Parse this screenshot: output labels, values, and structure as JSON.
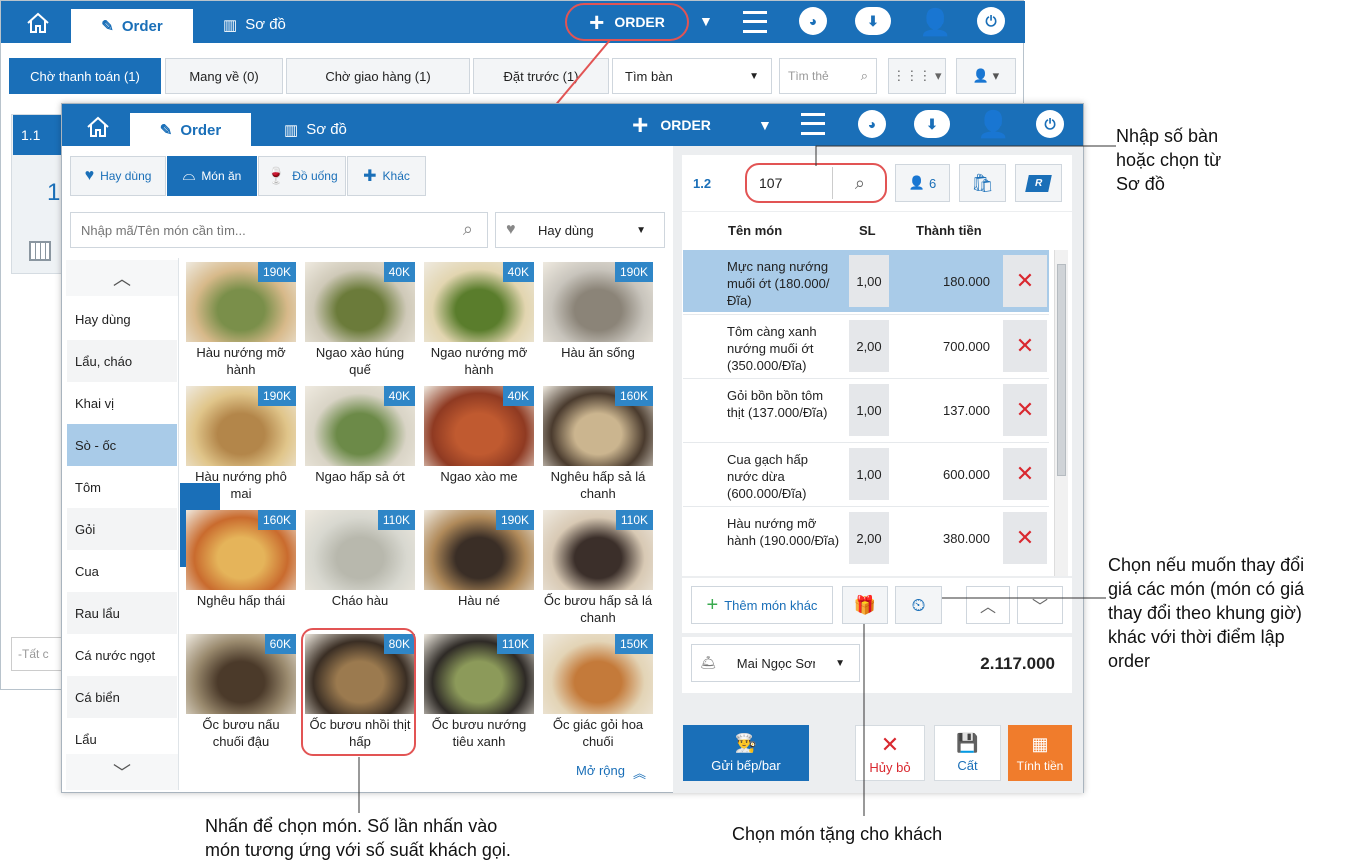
{
  "back_window": {
    "tabs": {
      "home": "",
      "order": "Order",
      "map": "Sơ đồ"
    },
    "order_button": "ORDER",
    "filters": [
      "Chờ thanh toán (1)",
      "Mang về (0)",
      "Chờ giao hàng (1)",
      "Đặt trước (1)"
    ],
    "table_select": "Tìm bàn",
    "search_placeholder": "Tìm thẻ",
    "left_table": "1.1",
    "left_big": "1",
    "bottom_input": "-Tất c"
  },
  "front_window": {
    "tabs": {
      "order": "Order",
      "map": "Sơ đồ"
    },
    "order_button": "ORDER",
    "category_tabs": [
      "Hay dùng",
      "Món ăn",
      "Đồ uống",
      "Khác"
    ],
    "search_placeholder": "Nhập mã/Tên món cần tìm...",
    "filter_select": "Hay dùng",
    "categories": [
      "Hay dùng",
      "Lẩu, cháo",
      "Khai vị",
      "Sò - ốc",
      "Tôm",
      "Gỏi",
      "Cua",
      "Rau lẩu",
      "Cá nước ngọt",
      "Cá biển",
      "Lẩu"
    ],
    "foods": [
      {
        "name": "Hàu nướng mỡ hành",
        "price": "190K"
      },
      {
        "name": "Ngao xào húng quế",
        "price": "40K"
      },
      {
        "name": "Ngao nướng mỡ hành",
        "price": "40K"
      },
      {
        "name": "Hàu ăn sống",
        "price": "190K"
      },
      {
        "name": "Hàu nướng phô mai",
        "price": "190K"
      },
      {
        "name": "Ngao hấp sả ớt",
        "price": "40K"
      },
      {
        "name": "Ngao xào me",
        "price": "40K"
      },
      {
        "name": "Nghêu hấp sả lá chanh",
        "price": "160K"
      },
      {
        "name": "Nghêu hấp thái",
        "price": "160K"
      },
      {
        "name": "Cháo hàu",
        "price": "110K"
      },
      {
        "name": "Hàu né",
        "price": "190K"
      },
      {
        "name": "Ốc bươu hấp sả lá chanh",
        "price": "110K"
      },
      {
        "name": "Ốc bươu nấu chuối đậu",
        "price": "60K"
      },
      {
        "name": "Ốc bươu nhồi thịt hấp",
        "price": "80K"
      },
      {
        "name": "Ốc bươu nướng tiêu xanh",
        "price": "110K"
      },
      {
        "name": "Ốc giác gỏi hoa chuối",
        "price": "150K"
      }
    ],
    "expand": "Mở rộng",
    "order_panel": {
      "table_no": "1.2",
      "table_input": "107",
      "guests": "6",
      "r_label": "R",
      "headers": {
        "name": "Tên món",
        "qty": "SL",
        "total": "Thành tiền"
      },
      "items": [
        {
          "name": "Mực nang nướng muối ớt (180.000/Đĩa)",
          "qty": "1,00",
          "total": "180.000"
        },
        {
          "name": "Tôm càng xanh nướng muối ớt (350.000/Đĩa)",
          "qty": "2,00",
          "total": "700.000"
        },
        {
          "name": "Gỏi bồn bồn tôm thịt (137.000/Đĩa)",
          "qty": "1,00",
          "total": "137.000"
        },
        {
          "name": "Cua gạch hấp nước dừa (600.000/Đĩa)",
          "qty": "1,00",
          "total": "600.000"
        },
        {
          "name": "Hàu nướng mỡ hành (190.000/Đĩa)",
          "qty": "2,00",
          "total": "380.000"
        }
      ],
      "add_other": "Thêm món khác",
      "waiter": "Mai Ngọc Sơn",
      "grand_total": "2.117.000",
      "send_kitchen": "Gửi bếp/bar",
      "cancel": "Hủy bỏ",
      "save": "Cất",
      "pay": "Tính tiền"
    }
  },
  "annotations": {
    "table": "Nhập số bàn\nhoặc chọn từ\nSơ đồ",
    "price_change": "Chọn nếu muốn thay đổi\ngiá các món (món có giá\nthay đổi theo khung giờ)\nkhác với thời điểm lập\norder",
    "food_tap": "Nhấn để chọn món. Số lần nhấn vào\nmón tương ứng với số suất khách gọi.",
    "gift": "Chọn món tặng cho khách"
  }
}
